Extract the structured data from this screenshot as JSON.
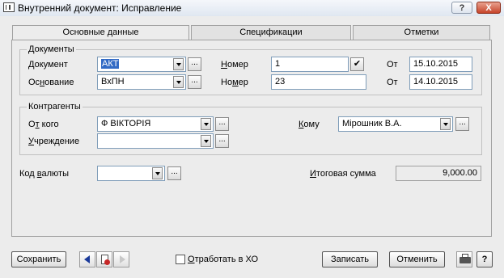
{
  "window": {
    "title": "Внутренний документ: Исправление",
    "help_label": "?",
    "close_label": "X"
  },
  "tabs": [
    {
      "label": "Основные данные",
      "active": true
    },
    {
      "label": "Спецификации",
      "active": false
    },
    {
      "label": "Отметки",
      "active": false
    }
  ],
  "documents": {
    "legend": "Документы",
    "document_label": "Документ",
    "document_value": "АКТ",
    "basis_label": "Основание",
    "basis_value": "ВхПН",
    "number_label": "Номер",
    "number_value": "1",
    "number2_label": "Номер",
    "number2_value": "23",
    "from_label": "От",
    "from_value": "15.10.2015",
    "from2_label": "От",
    "from2_value": "14.10.2015"
  },
  "contragents": {
    "legend": "Контрагенты",
    "from_whom_label": "От кого",
    "from_whom_value": "Ф ВІКТОРІЯ",
    "institution_label": "Учреждение",
    "institution_value": "",
    "to_whom_label": "Кому",
    "to_whom_value": "Мірошник В.А."
  },
  "currency": {
    "label": "Код валюты",
    "value": "",
    "total_label": "Итоговая сумма",
    "total_value": "9,000.00"
  },
  "footer": {
    "save_label": "Сохранить",
    "process_label": "Отработать в ХО",
    "record_label": "Записать",
    "cancel_label": "Отменить",
    "help_label": "?"
  },
  "ellipsis": "..."
}
